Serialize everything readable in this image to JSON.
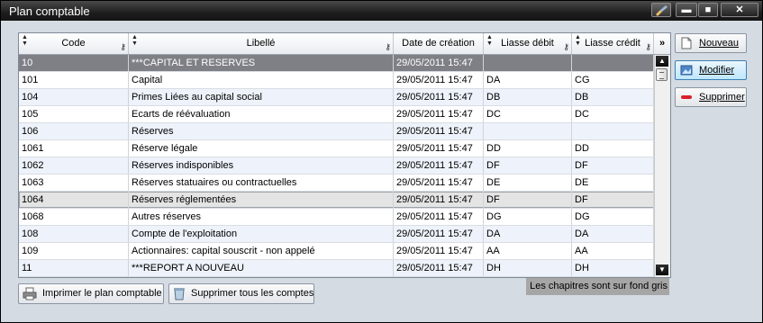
{
  "window": {
    "title": "Plan comptable"
  },
  "titlebar_buttons": {
    "minimize": "▬",
    "maximize": "■",
    "close": "✕"
  },
  "grid": {
    "columns": [
      "Code",
      "Libellé",
      "Date de création",
      "Liasse débit",
      "Liasse crédit"
    ],
    "more_columns_glyph": "»",
    "rows": [
      {
        "code": "10",
        "libelle": "***CAPITAL ET RESERVES",
        "date": "29/05/2011 15:47",
        "debit": "",
        "credit": "",
        "state": "chapter"
      },
      {
        "code": "101",
        "libelle": "Capital",
        "date": "29/05/2011 15:47",
        "debit": "DA",
        "credit": "CG",
        "state": "normal"
      },
      {
        "code": "104",
        "libelle": "Primes Liées au capital social",
        "date": "29/05/2011 15:47",
        "debit": "DB",
        "credit": "DB",
        "state": "alt"
      },
      {
        "code": "105",
        "libelle": "Ecarts de réévaluation",
        "date": "29/05/2011 15:47",
        "debit": "DC",
        "credit": "DC",
        "state": "normal"
      },
      {
        "code": "106",
        "libelle": "Réserves",
        "date": "29/05/2011 15:47",
        "debit": "",
        "credit": "",
        "state": "alt"
      },
      {
        "code": "1061",
        "libelle": "Réserve légale",
        "date": "29/05/2011 15:47",
        "debit": "DD",
        "credit": "DD",
        "state": "normal"
      },
      {
        "code": "1062",
        "libelle": "Réserves indisponibles",
        "date": "29/05/2011 15:47",
        "debit": "DF",
        "credit": "DF",
        "state": "alt"
      },
      {
        "code": "1063",
        "libelle": "Réserves statuaires ou contractuelles",
        "date": "29/05/2011 15:47",
        "debit": "DE",
        "credit": "DE",
        "state": "normal"
      },
      {
        "code": "1064",
        "libelle": "Réserves réglementées",
        "date": "29/05/2011 15:47",
        "debit": "DF",
        "credit": "DF",
        "state": "selected"
      },
      {
        "code": "1068",
        "libelle": "Autres réserves",
        "date": "29/05/2011 15:47",
        "debit": "DG",
        "credit": "DG",
        "state": "normal"
      },
      {
        "code": "108",
        "libelle": "Compte de l'exploitation",
        "date": "29/05/2011 15:47",
        "debit": "DA",
        "credit": "DA",
        "state": "alt"
      },
      {
        "code": "109",
        "libelle": "Actionnaires: capital souscrit - non appelé",
        "date": "29/05/2011 15:47",
        "debit": "AA",
        "credit": "AA",
        "state": "normal"
      },
      {
        "code": "11",
        "libelle": "***REPORT A NOUVEAU",
        "date": "29/05/2011 15:47",
        "debit": "DH",
        "credit": "DH",
        "state": "alt"
      }
    ]
  },
  "actions": {
    "nouveau": "Nouveau",
    "modifier": "Modifier",
    "supprimer": "Supprimer"
  },
  "footer": {
    "print_label": "Imprimer le plan comptable",
    "delete_all_label": "Supprimer tous les comptes",
    "note": "Les chapitres sont sur fond gris"
  }
}
